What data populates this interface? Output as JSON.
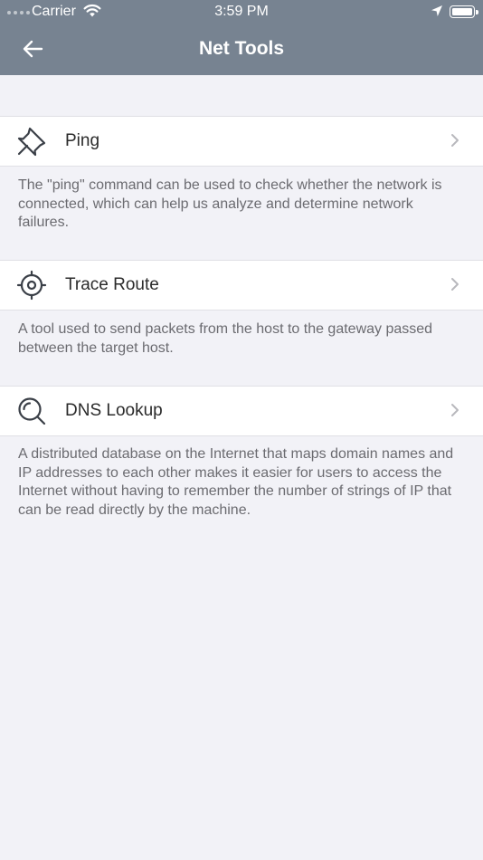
{
  "status_bar": {
    "carrier": "Carrier",
    "time": "3:59 PM"
  },
  "nav": {
    "title": "Net Tools",
    "back_icon": "arrow-left-icon"
  },
  "tools": [
    {
      "label": "Ping",
      "icon": "pin-icon",
      "description": "The \"ping\" command can be used to check whether the network is connected, which can help us analyze and determine network failures."
    },
    {
      "label": "Trace Route",
      "icon": "crosshair-icon",
      "description": "A tool used to send packets from the host to the gateway passed between the target host."
    },
    {
      "label": "DNS Lookup",
      "icon": "magnifier-icon",
      "description": "A distributed database on the Internet that maps domain names and IP addresses to each other makes it easier for users to access the Internet without having to remember the number of strings of IP that can be read directly by the machine."
    }
  ],
  "colors": {
    "header_bg": "#778391",
    "page_bg": "#f2f2f7",
    "row_bg": "#ffffff",
    "text_primary": "#2b2b2b",
    "text_secondary": "#6b6b70"
  }
}
